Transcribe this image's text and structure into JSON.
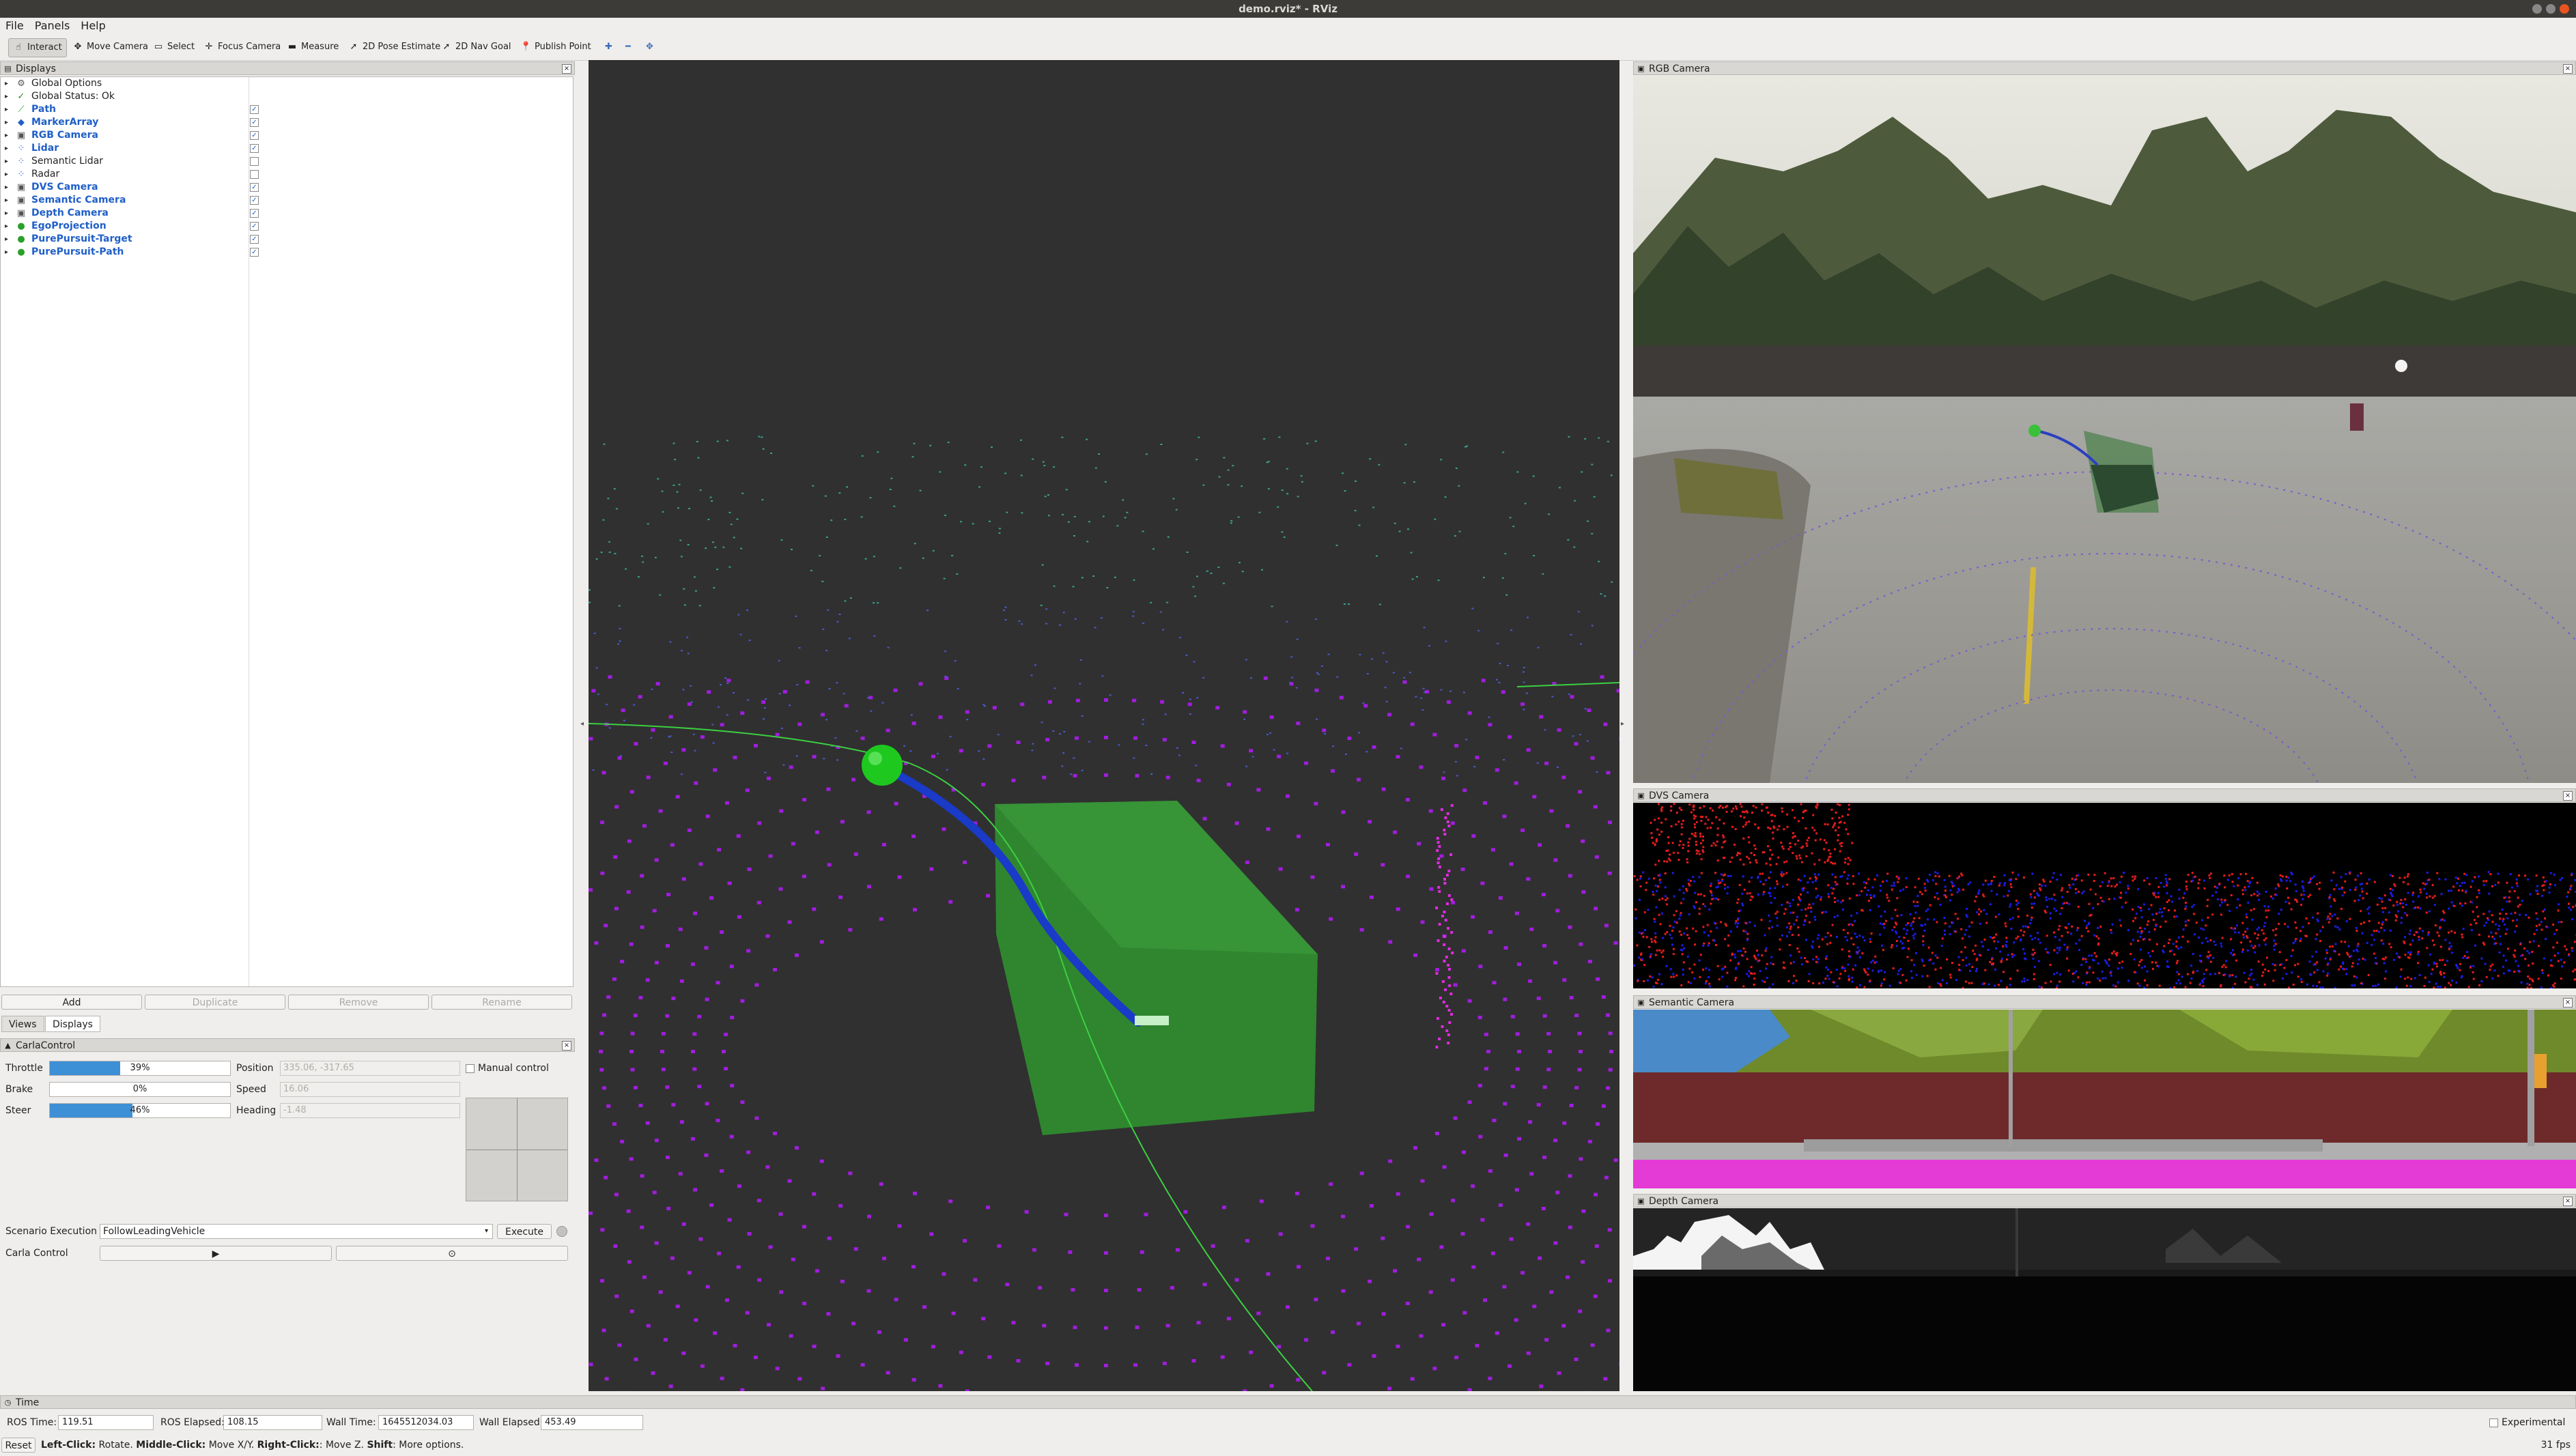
{
  "window": {
    "title": "demo.rviz* - RViz"
  },
  "menu": [
    "File",
    "Panels",
    "Help"
  ],
  "toolbar": {
    "tools": [
      {
        "label": "Interact",
        "icon": "interact-icon",
        "glyph": "☝"
      },
      {
        "label": "Move Camera",
        "icon": "move-camera-icon",
        "glyph": "✥"
      },
      {
        "label": "Select",
        "icon": "select-icon",
        "glyph": "▭"
      },
      {
        "label": "Focus Camera",
        "icon": "focus-camera-icon",
        "glyph": "✛"
      },
      {
        "label": "Measure",
        "icon": "measure-icon",
        "glyph": "▬"
      },
      {
        "label": "2D Pose Estimate",
        "icon": "pose-estimate-icon",
        "glyph": "➚"
      },
      {
        "label": "2D Nav Goal",
        "icon": "nav-goal-icon",
        "glyph": "➚"
      },
      {
        "label": "Publish Point",
        "icon": "publish-point-icon",
        "glyph": "📍"
      }
    ],
    "extra_icons": [
      "plus-icon",
      "minus-icon",
      "dropdown-icon"
    ]
  },
  "displays": {
    "title": "Displays",
    "items": [
      {
        "label": "Global Options",
        "icon": "gear-icon",
        "glyph": "⚙",
        "color": "#555555",
        "checked": null,
        "enabled": false
      },
      {
        "label": "Global Status: Ok",
        "icon": "check-icon",
        "glyph": "✓",
        "color": "#2a8a2a",
        "checked": null,
        "enabled": false
      },
      {
        "label": "Path",
        "icon": "path-icon",
        "glyph": "⟋",
        "color": "#2aa02a",
        "checked": true,
        "enabled": true
      },
      {
        "label": "MarkerArray",
        "icon": "marker-array-icon",
        "glyph": "◆",
        "color": "#1f5fc8",
        "checked": true,
        "enabled": true
      },
      {
        "label": "RGB Camera",
        "icon": "camera-icon",
        "glyph": "▣",
        "color": "#555555",
        "checked": true,
        "enabled": true
      },
      {
        "label": "Lidar",
        "icon": "pointcloud-icon",
        "glyph": "⁘",
        "color": "#1f5fc8",
        "checked": true,
        "enabled": true
      },
      {
        "label": "Semantic Lidar",
        "icon": "pointcloud-icon",
        "glyph": "⁘",
        "color": "#1f5fc8",
        "checked": false,
        "enabled": false
      },
      {
        "label": "Radar",
        "icon": "pointcloud-icon",
        "glyph": "⁘",
        "color": "#1f5fc8",
        "checked": false,
        "enabled": false
      },
      {
        "label": "DVS Camera",
        "icon": "camera-icon",
        "glyph": "▣",
        "color": "#555555",
        "checked": true,
        "enabled": true
      },
      {
        "label": "Semantic Camera",
        "icon": "camera-icon",
        "glyph": "▣",
        "color": "#555555",
        "checked": true,
        "enabled": true
      },
      {
        "label": "Depth Camera",
        "icon": "camera-icon",
        "glyph": "▣",
        "color": "#555555",
        "checked": true,
        "enabled": true
      },
      {
        "label": "EgoProjection",
        "icon": "marker-icon",
        "glyph": "●",
        "color": "#2aa02a",
        "checked": true,
        "enabled": true
      },
      {
        "label": "PurePursuit-Target",
        "icon": "marker-icon",
        "glyph": "●",
        "color": "#2aa02a",
        "checked": true,
        "enabled": true
      },
      {
        "label": "PurePursuit-Path",
        "icon": "marker-icon",
        "glyph": "●",
        "color": "#2aa02a",
        "checked": true,
        "enabled": true
      }
    ],
    "buttons": {
      "add": "Add",
      "duplicate": "Duplicate",
      "remove": "Remove",
      "rename": "Rename"
    }
  },
  "tabs": [
    "Views",
    "Displays"
  ],
  "carla": {
    "title": "CarlaControl",
    "throttle": {
      "label": "Throttle",
      "value": 0.39,
      "text": "39%"
    },
    "brake": {
      "label": "Brake",
      "value": 0.0,
      "text": "0%"
    },
    "steer": {
      "label": "Steer",
      "value": 0.46,
      "text": "46%"
    },
    "position": {
      "label": "Position",
      "value": "335.06, -317.65"
    },
    "speed": {
      "label": "Speed",
      "value": "16.06"
    },
    "heading": {
      "label": "Heading",
      "value": "-1.48"
    },
    "manual_control": "Manual control",
    "scenario_label": "Scenario Execution",
    "scenario_value": "FollowLeadingVehicle",
    "execute": "Execute",
    "carla_control_label": "Carla Control",
    "play_glyph": "▶",
    "stop_glyph": "⊙"
  },
  "cameras": {
    "rgb": "RGB Camera",
    "dvs": "DVS Camera",
    "semantic": "Semantic Camera",
    "depth": "Depth Camera"
  },
  "time": {
    "title": "Time",
    "ros_time_label": "ROS Time:",
    "ros_time": "119.51",
    "ros_elapsed_label": "ROS Elapsed:",
    "ros_elapsed": "108.15",
    "wall_time_label": "Wall Time:",
    "wall_time": "1645512034.03",
    "wall_elapsed_label": "Wall Elapsed:",
    "wall_elapsed": "453.49",
    "experimental": "Experimental"
  },
  "status": {
    "reset": "Reset",
    "help_parts": [
      {
        "t": "Left-Click:",
        "b": true
      },
      {
        "t": " Rotate. ",
        "b": false
      },
      {
        "t": "Middle-Click:",
        "b": true
      },
      {
        "t": " Move X/Y. ",
        "b": false
      },
      {
        "t": "Right-Click:",
        "b": true
      },
      {
        "t": ": Move Z. ",
        "b": false
      },
      {
        "t": "Shift",
        "b": true
      },
      {
        "t": ": More options.",
        "b": false
      }
    ],
    "fps": "31 fps"
  }
}
